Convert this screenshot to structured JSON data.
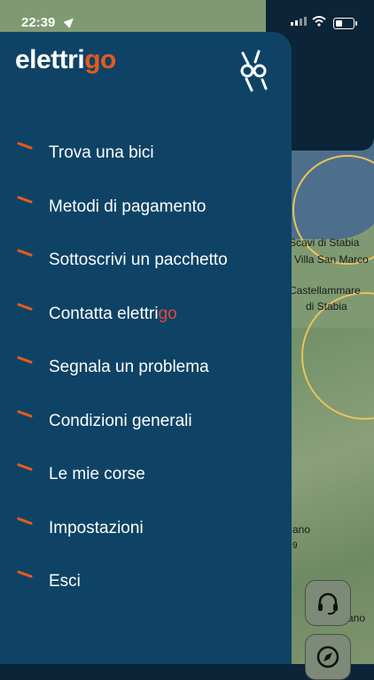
{
  "status_bar": {
    "time": "22:39"
  },
  "brand": {
    "logo_main": "elettri",
    "logo_accent": "go"
  },
  "menu": {
    "items": [
      {
        "label": "Trova una bici"
      },
      {
        "label": "Metodi di pagamento"
      },
      {
        "label": "Sottoscrivi un pacchetto"
      },
      {
        "label": "Contatta elettri",
        "accent": "go"
      },
      {
        "label": "Segnala un problema"
      },
      {
        "label": "Condizioni generali"
      },
      {
        "label": "Le mie corse"
      },
      {
        "label": "Impostazioni"
      },
      {
        "label": "Esci"
      }
    ]
  },
  "map": {
    "labels": [
      "Scavi di Stabia",
      "Villa San Marco",
      "Castellammare",
      "di Stabia",
      "ano",
      "9",
      "ano"
    ]
  },
  "colors": {
    "drawer": "#0e4366",
    "accent": "#e65a1e",
    "header": "#0b2438"
  },
  "icons": {
    "headset": "headset-icon",
    "compass": "compass-icon",
    "location": "location-arrow-icon"
  }
}
